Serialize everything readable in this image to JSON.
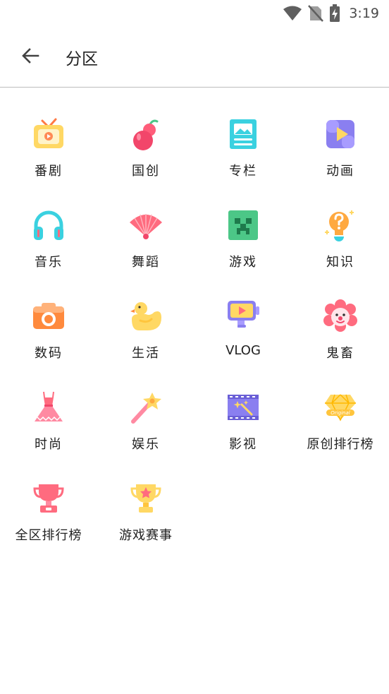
{
  "status_bar": {
    "time": "3:19"
  },
  "header": {
    "title": "分区"
  },
  "categories": [
    {
      "label": "番剧",
      "icon": "tv-icon"
    },
    {
      "label": "国创",
      "icon": "gourd-icon"
    },
    {
      "label": "专栏",
      "icon": "article-icon"
    },
    {
      "label": "动画",
      "icon": "animation-icon"
    },
    {
      "label": "音乐",
      "icon": "headphones-icon"
    },
    {
      "label": "舞蹈",
      "icon": "fan-icon"
    },
    {
      "label": "游戏",
      "icon": "creeper-icon"
    },
    {
      "label": "知识",
      "icon": "lightbulb-icon"
    },
    {
      "label": "数码",
      "icon": "camera-icon"
    },
    {
      "label": "生活",
      "icon": "duck-icon"
    },
    {
      "label": "VLOG",
      "icon": "vlog-camera-icon"
    },
    {
      "label": "鬼畜",
      "icon": "clown-icon"
    },
    {
      "label": "时尚",
      "icon": "dress-icon"
    },
    {
      "label": "娱乐",
      "icon": "magic-wand-icon"
    },
    {
      "label": "影视",
      "icon": "film-icon"
    },
    {
      "label": "原创排行榜",
      "icon": "original-diamond-icon"
    },
    {
      "label": "全区排行榜",
      "icon": "red-trophy-icon"
    },
    {
      "label": "游戏赛事",
      "icon": "gold-trophy-icon"
    }
  ]
}
